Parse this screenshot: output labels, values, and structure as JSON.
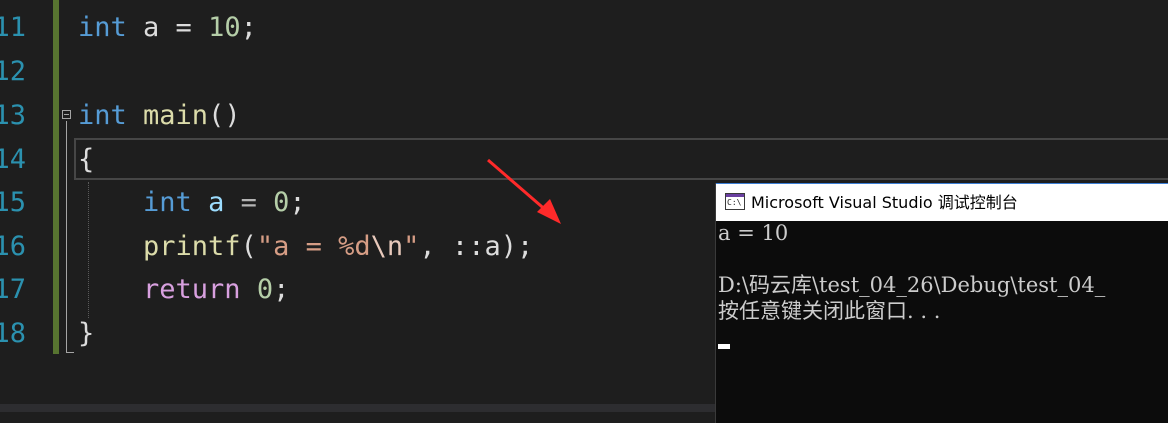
{
  "editor": {
    "line_numbers": [
      "11",
      "12",
      "13",
      "14",
      "15",
      "16",
      "17",
      "18"
    ],
    "lines": {
      "l11": {
        "kw": "int",
        "rest": " a = ",
        "num": "10",
        "end": ";"
      },
      "l13": {
        "kw": "int",
        "fn": " main",
        "rest": "()"
      },
      "l14": {
        "text": "{"
      },
      "l15": {
        "indent": "    ",
        "kw": "int",
        "id": " a",
        "op": " = ",
        "num": "0",
        "end": ";"
      },
      "l16": {
        "indent": "    ",
        "fn": "printf",
        "open": "(",
        "str1": "\"a = %d",
        "esc": "\\n",
        "str2": "\"",
        "mid": ", ::",
        "id": "a",
        "end": ");"
      },
      "l17": {
        "indent": "    ",
        "ctl": "return",
        "sp": " ",
        "num": "0",
        "end": ";"
      },
      "l18": {
        "text": "}"
      }
    }
  },
  "console": {
    "title": "Microsoft Visual Studio 调试控制台",
    "icon_label": "C:\\",
    "icon": "console-app-icon",
    "output": [
      "a = 10",
      "",
      "D:\\码云库\\test_04_26\\Debug\\test_04_",
      "按任意键关闭此窗口. . ."
    ]
  },
  "annotation": {
    "icon": "red-arrow-annotation",
    "color": "#ff2a2a"
  }
}
